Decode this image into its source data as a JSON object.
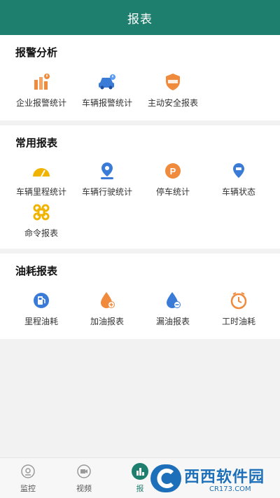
{
  "header": {
    "title": "报表"
  },
  "sections": [
    {
      "title": "报警分析",
      "items": [
        {
          "label": "企业报警统计",
          "icon": "enterprise-alarm-icon"
        },
        {
          "label": "车辆报警统计",
          "icon": "vehicle-alarm-icon"
        },
        {
          "label": "主动安全报表",
          "icon": "active-safety-icon"
        }
      ]
    },
    {
      "title": "常用报表",
      "items": [
        {
          "label": "车辆里程统计",
          "icon": "speedometer-icon"
        },
        {
          "label": "车辆行驶统计",
          "icon": "location-pin-icon"
        },
        {
          "label": "停车统计",
          "icon": "parking-icon"
        },
        {
          "label": "车辆状态",
          "icon": "vehicle-status-icon"
        },
        {
          "label": "命令报表",
          "icon": "command-icon"
        }
      ]
    },
    {
      "title": "油耗报表",
      "items": [
        {
          "label": "里程油耗",
          "icon": "fuel-pump-icon"
        },
        {
          "label": "加油报表",
          "icon": "refuel-drop-icon"
        },
        {
          "label": "漏油报表",
          "icon": "oil-leak-drop-icon"
        },
        {
          "label": "工时油耗",
          "icon": "work-hours-clock-icon"
        }
      ]
    }
  ],
  "bottom_nav": [
    {
      "label": "监控",
      "icon": "monitor-icon"
    },
    {
      "label": "视频",
      "icon": "video-icon"
    },
    {
      "label": "报",
      "icon": "report-icon"
    }
  ],
  "watermark": {
    "big": "西西软件园",
    "small": "CR173.COM"
  },
  "colors": {
    "primary": "#1f7f6e",
    "orange": "#f08a3c",
    "blue": "#3b7bd8",
    "yellow": "#f0b400"
  }
}
